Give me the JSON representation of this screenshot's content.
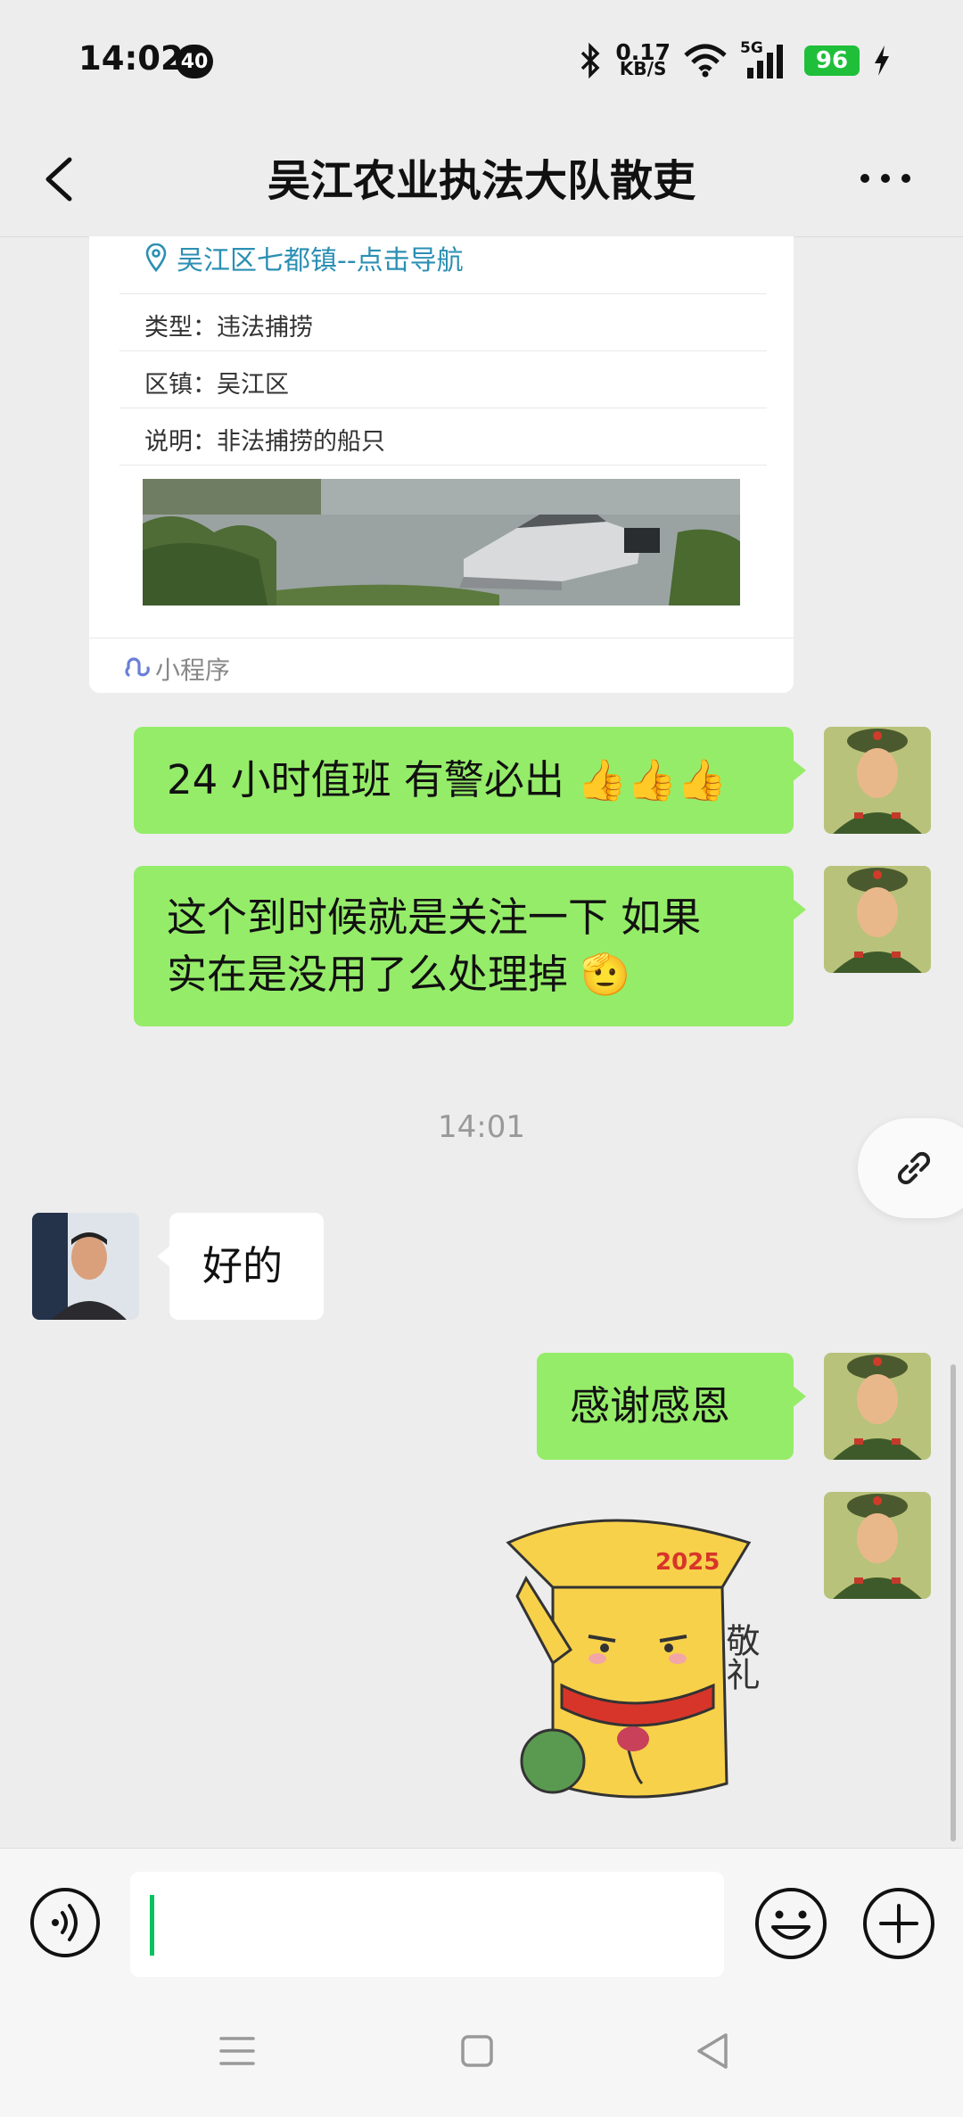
{
  "status_bar": {
    "time": "14:02",
    "notification_count": "40",
    "net_speed_value": "0.17",
    "net_speed_unit": "KB/S",
    "network": "5G",
    "battery": "96"
  },
  "header": {
    "title": "吴江农业执法大队散吏"
  },
  "mini_program_card": {
    "location": "吴江区七都镇--点击导航",
    "type_row": "类型：违法捕捞",
    "district_row": "区镇：吴江区",
    "desc_row": "说明：非法捕捞的船只",
    "footer_label": "小程序"
  },
  "messages": [
    {
      "sender": "me",
      "text": "24 小时值班 有警必出 👍👍👍"
    },
    {
      "sender": "me",
      "text_line1": "这个到时候就是关注一下 如果",
      "text_line2": "实在是没用了么处理掉 🫡"
    },
    {
      "type": "timestamp",
      "text": "14:01"
    },
    {
      "sender": "other",
      "text": "好的"
    },
    {
      "sender": "me",
      "text": "感谢感恩"
    },
    {
      "sender": "me",
      "type": "sticker",
      "sticker_text": "敬礼",
      "sticker_year": "2025"
    }
  ],
  "input_bar": {
    "value": ""
  },
  "colors": {
    "my_bubble": "#95ec69",
    "other_bubble": "#ffffff",
    "background": "#ededed",
    "link": "#2b8fb3"
  }
}
